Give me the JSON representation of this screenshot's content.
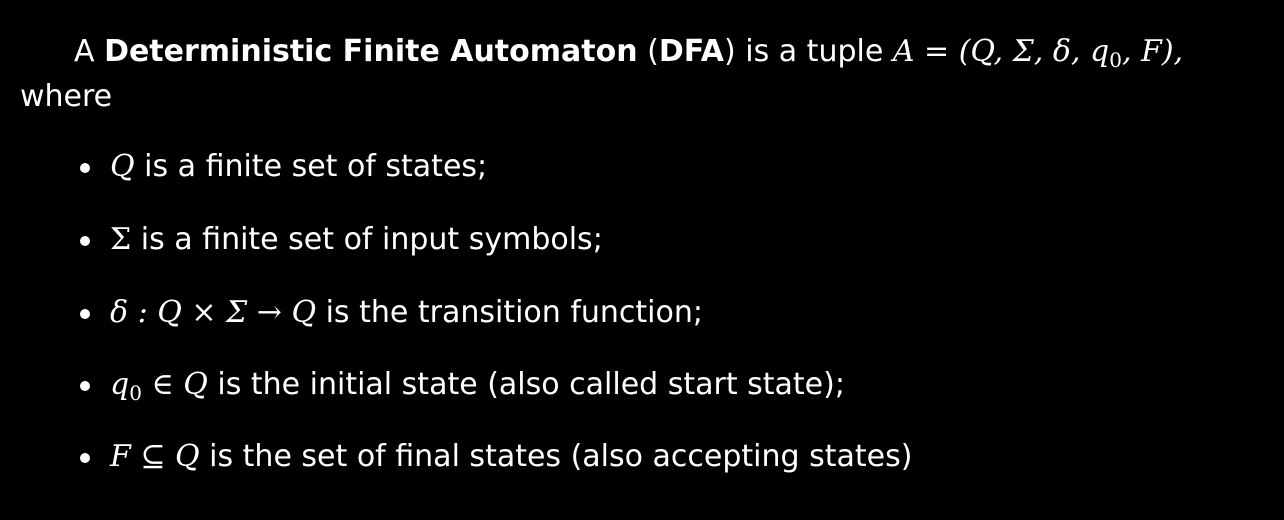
{
  "intro": {
    "prefix": "A ",
    "term": "Deterministic Finite Automaton",
    "abbr_open": " (",
    "abbr": "DFA",
    "abbr_close": ")",
    "middle": " is a tuple ",
    "tuple_math": "A = (Q, Σ, δ, q",
    "tuple_sub": "0",
    "tuple_end": ", F),",
    "continuation": "where"
  },
  "items": [
    {
      "math": "Q",
      "text": " is a finite set of states;"
    },
    {
      "math": "Σ",
      "text": " is a finite set of input symbols;"
    },
    {
      "math": "δ : Q × Σ → Q",
      "text": " is the transition function;"
    },
    {
      "math": "q",
      "sub": "0",
      "math_after": " ∈ Q",
      "text": " is the initial state (also called start state);"
    },
    {
      "math": "F ⊆ Q",
      "text": " is the set of final states (also accepting states)"
    }
  ]
}
